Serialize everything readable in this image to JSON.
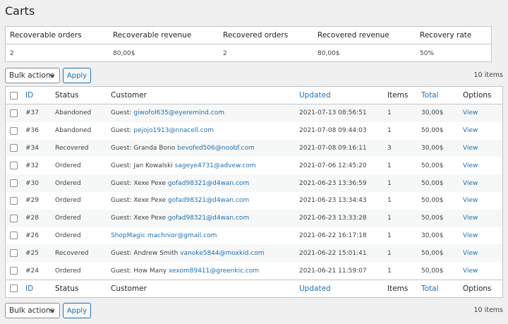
{
  "page": {
    "title": "Carts"
  },
  "stats": {
    "headers": [
      "Recoverable orders",
      "Recoverable revenue",
      "Recovered orders",
      "Recovered revenue",
      "Recovery rate"
    ],
    "values": [
      "2",
      "80,00$",
      "2",
      "80,00$",
      "50%"
    ]
  },
  "toolbar": {
    "bulk_actions": "Bulk actions",
    "apply": "Apply",
    "items_count": "10 items"
  },
  "table": {
    "columns": {
      "id": "ID",
      "status": "Status",
      "customer": "Customer",
      "updated": "Updated",
      "items": "Items",
      "total": "Total",
      "options": "Options"
    },
    "rows": [
      {
        "id": "#37",
        "status": "Abandoned",
        "customer_prefix": "Guest: ",
        "email": "giwofol635@eyeremind.com",
        "updated": "2021-07-13 08:56:51",
        "items": "1",
        "total": "30,00$",
        "option": "View"
      },
      {
        "id": "#36",
        "status": "Abandoned",
        "customer_prefix": "Guest: ",
        "email": "pejojo1913@nnacell.com",
        "updated": "2021-07-08 09:44:03",
        "items": "1",
        "total": "50,00$",
        "option": "View"
      },
      {
        "id": "#34",
        "status": "Recovered",
        "customer_prefix": "Guest: Granda Bono ",
        "email": "bevofed506@noobf.com",
        "updated": "2021-07-08 09:16:11",
        "items": "3",
        "total": "30,00$",
        "option": "View"
      },
      {
        "id": "#32",
        "status": "Ordered",
        "customer_prefix": "Guest: Jan Kowalski ",
        "email": "sageye4731@advew.com",
        "updated": "2021-07-06 12:45:20",
        "items": "1",
        "total": "50,00$",
        "option": "View"
      },
      {
        "id": "#30",
        "status": "Ordered",
        "customer_prefix": "Guest: Xexe Pexe ",
        "email": "gofad98321@d4wan.com",
        "updated": "2021-06-23 13:36:59",
        "items": "1",
        "total": "50,00$",
        "option": "View"
      },
      {
        "id": "#29",
        "status": "Ordered",
        "customer_prefix": "Guest: Xexe Pexe ",
        "email": "gofad98321@d4wan.com",
        "updated": "2021-06-23 13:34:43",
        "items": "1",
        "total": "50,00$",
        "option": "View"
      },
      {
        "id": "#28",
        "status": "Ordered",
        "customer_prefix": "Guest: Xexe Pexe ",
        "email": "gofad98321@d4wan.com",
        "updated": "2021-06-23 13:33:28",
        "items": "1",
        "total": "50,00$",
        "option": "View"
      },
      {
        "id": "#26",
        "status": "Ordered",
        "customer_prefix": "",
        "email": "ShopMagic machnior@gmail.com",
        "updated": "2021-06-22 16:17:18",
        "items": "1",
        "total": "30,00$",
        "option": "View"
      },
      {
        "id": "#25",
        "status": "Recovered",
        "customer_prefix": "Guest: Andrew Smith ",
        "email": "vanoke5844@moxkid.com",
        "updated": "2021-06-22 15:01:41",
        "items": "1",
        "total": "50,00$",
        "option": "View"
      },
      {
        "id": "#24",
        "status": "Ordered",
        "customer_prefix": "Guest: How Many ",
        "email": "xexom89411@greenkic.com",
        "updated": "2021-06-21 11:59:07",
        "items": "1",
        "total": "50,00$",
        "option": "View"
      }
    ]
  },
  "colors": {
    "link": "#2271b1",
    "background": "#f0f0f1",
    "border": "#c3c4c7"
  },
  "icons": {
    "bulk_dropdown": "chevron-down-icon"
  }
}
